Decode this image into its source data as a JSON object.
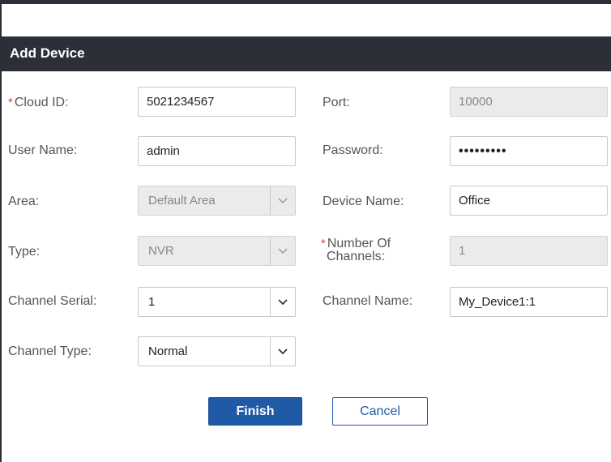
{
  "dialog": {
    "title": "Add Device",
    "fields": {
      "cloud_id": {
        "label": "Cloud ID:",
        "required_mark": "*",
        "value": "5021234567"
      },
      "port": {
        "label": "Port:",
        "value": "10000"
      },
      "user_name": {
        "label": "User Name:",
        "value": "admin"
      },
      "password": {
        "label": "Password:",
        "value": "•••••••••"
      },
      "area": {
        "label": "Area:",
        "value": "Default Area"
      },
      "device_name": {
        "label": "Device Name:",
        "value": "Office"
      },
      "type": {
        "label": "Type:",
        "value": "NVR"
      },
      "number_of_channels": {
        "label_line1": "Number Of",
        "label_line2": "Channels:",
        "required_mark": "*",
        "value": "1"
      },
      "channel_serial": {
        "label": "Channel Serial:",
        "value": "1"
      },
      "channel_name": {
        "label": "Channel Name:",
        "value": "My_Device1:1"
      },
      "channel_type": {
        "label": "Channel Type:",
        "value": "Normal"
      }
    },
    "buttons": {
      "finish": "Finish",
      "cancel": "Cancel"
    }
  },
  "colors": {
    "header_bg": "#2d2f38",
    "primary": "#1f5aa6",
    "required": "#e0453b"
  },
  "icons": {
    "dropdown": "chevron-down-icon"
  }
}
